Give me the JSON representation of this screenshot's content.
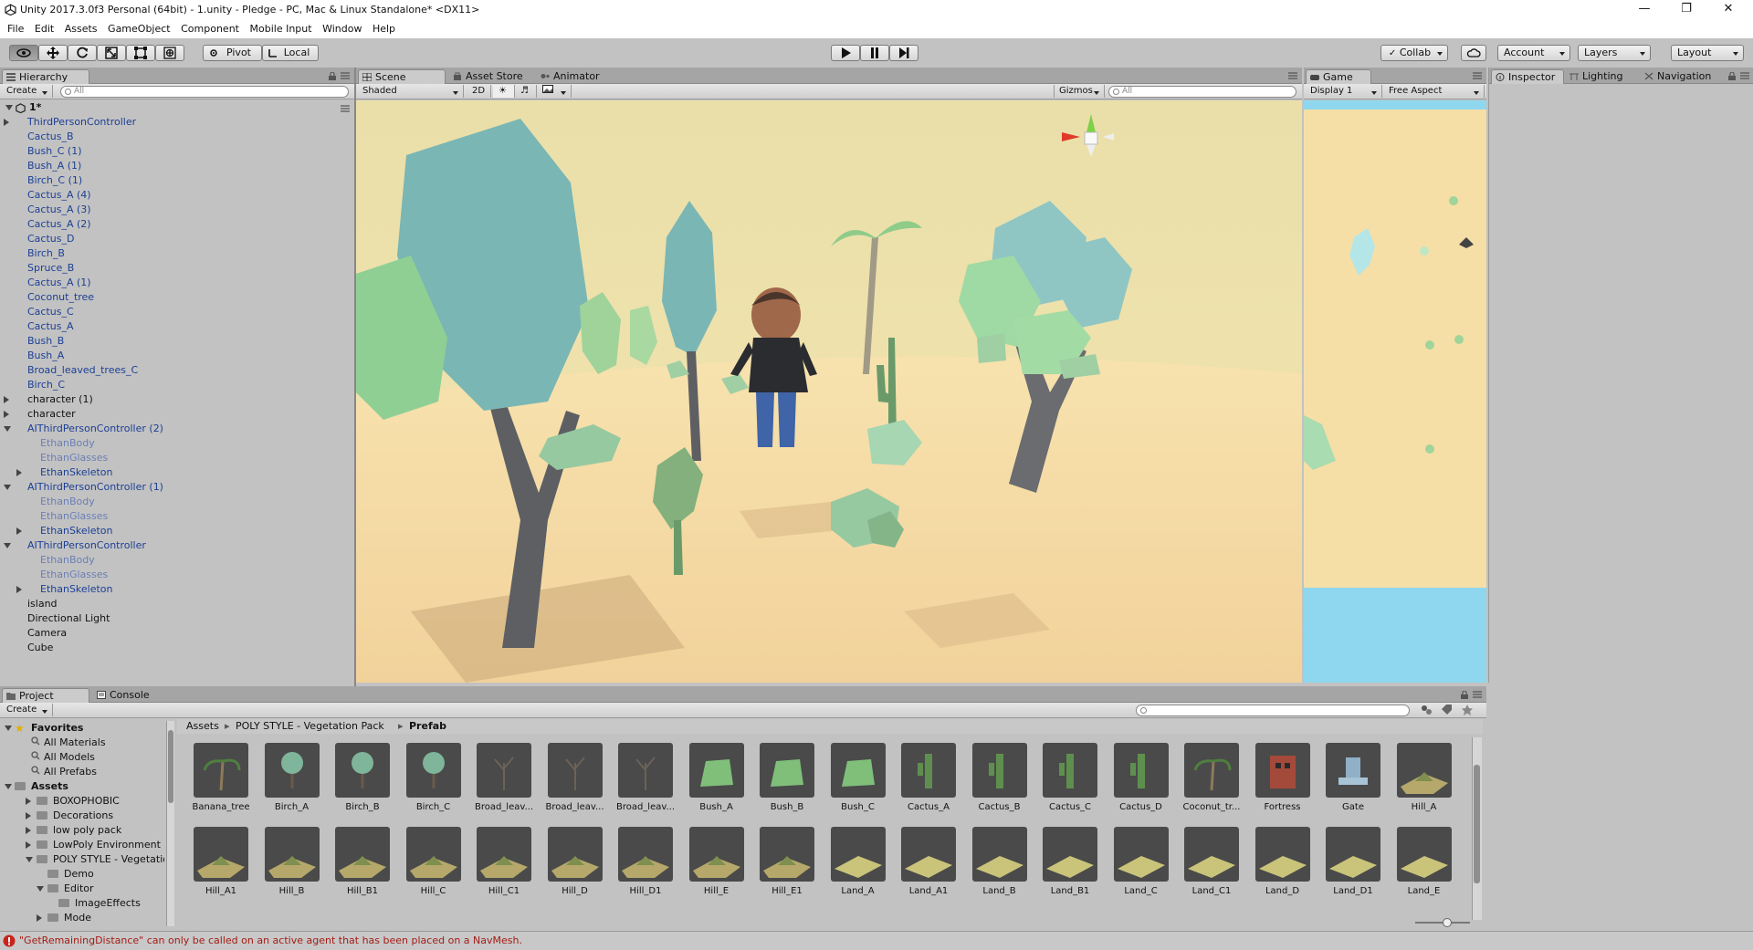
{
  "window": {
    "title": "Unity 2017.3.0f3 Personal (64bit) - 1.unity - Pledge - PC, Mac & Linux Standalone* <DX11>",
    "controls": [
      "—",
      "❐",
      "✕"
    ]
  },
  "menu": [
    "File",
    "Edit",
    "Assets",
    "GameObject",
    "Component",
    "Mobile Input",
    "Window",
    "Help"
  ],
  "toolbar": {
    "pivot": "Pivot",
    "local": "Local",
    "collab": "Collab",
    "account": "Account",
    "layers": "Layers",
    "layout": "Layout"
  },
  "hierarchy": {
    "tab": "Hierarchy",
    "create": "Create",
    "search_placeholder": "All",
    "scene_name": "1*",
    "items": [
      {
        "label": "ThirdPersonController",
        "color": "blue",
        "indent": 0,
        "arrow": "right"
      },
      {
        "label": "Cactus_B",
        "color": "blue",
        "indent": 0,
        "arrow": ""
      },
      {
        "label": "Bush_C (1)",
        "color": "blue",
        "indent": 0,
        "arrow": ""
      },
      {
        "label": "Bush_A (1)",
        "color": "blue",
        "indent": 0,
        "arrow": ""
      },
      {
        "label": "Birch_C (1)",
        "color": "blue",
        "indent": 0,
        "arrow": ""
      },
      {
        "label": "Cactus_A (4)",
        "color": "blue",
        "indent": 0,
        "arrow": ""
      },
      {
        "label": "Cactus_A (3)",
        "color": "blue",
        "indent": 0,
        "arrow": ""
      },
      {
        "label": "Cactus_A (2)",
        "color": "blue",
        "indent": 0,
        "arrow": ""
      },
      {
        "label": "Cactus_D",
        "color": "blue",
        "indent": 0,
        "arrow": ""
      },
      {
        "label": "Birch_B",
        "color": "blue",
        "indent": 0,
        "arrow": ""
      },
      {
        "label": "Spruce_B",
        "color": "blue",
        "indent": 0,
        "arrow": ""
      },
      {
        "label": "Cactus_A (1)",
        "color": "blue",
        "indent": 0,
        "arrow": ""
      },
      {
        "label": "Coconut_tree",
        "color": "blue",
        "indent": 0,
        "arrow": ""
      },
      {
        "label": "Cactus_C",
        "color": "blue",
        "indent": 0,
        "arrow": ""
      },
      {
        "label": "Cactus_A",
        "color": "blue",
        "indent": 0,
        "arrow": ""
      },
      {
        "label": "Bush_B",
        "color": "blue",
        "indent": 0,
        "arrow": ""
      },
      {
        "label": "Bush_A",
        "color": "blue",
        "indent": 0,
        "arrow": ""
      },
      {
        "label": "Broad_leaved_trees_C",
        "color": "blue",
        "indent": 0,
        "arrow": ""
      },
      {
        "label": "Birch_C",
        "color": "blue",
        "indent": 0,
        "arrow": ""
      },
      {
        "label": "character (1)",
        "color": "black",
        "indent": 0,
        "arrow": "right"
      },
      {
        "label": "character",
        "color": "black",
        "indent": 0,
        "arrow": "right"
      },
      {
        "label": "AIThirdPersonController (2)",
        "color": "blue",
        "indent": 0,
        "arrow": "down"
      },
      {
        "label": "EthanBody",
        "color": "lblue",
        "indent": 1,
        "arrow": ""
      },
      {
        "label": "EthanGlasses",
        "color": "lblue",
        "indent": 1,
        "arrow": ""
      },
      {
        "label": "EthanSkeleton",
        "color": "blue",
        "indent": 1,
        "arrow": "right"
      },
      {
        "label": "AIThirdPersonController (1)",
        "color": "blue",
        "indent": 0,
        "arrow": "down"
      },
      {
        "label": "EthanBody",
        "color": "lblue",
        "indent": 1,
        "arrow": ""
      },
      {
        "label": "EthanGlasses",
        "color": "lblue",
        "indent": 1,
        "arrow": ""
      },
      {
        "label": "EthanSkeleton",
        "color": "blue",
        "indent": 1,
        "arrow": "right"
      },
      {
        "label": "AIThirdPersonController",
        "color": "blue",
        "indent": 0,
        "arrow": "down"
      },
      {
        "label": "EthanBody",
        "color": "lblue",
        "indent": 1,
        "arrow": ""
      },
      {
        "label": "EthanGlasses",
        "color": "lblue",
        "indent": 1,
        "arrow": ""
      },
      {
        "label": "EthanSkeleton",
        "color": "blue",
        "indent": 1,
        "arrow": "right"
      },
      {
        "label": "island",
        "color": "black",
        "indent": 0,
        "arrow": ""
      },
      {
        "label": "Directional Light",
        "color": "black",
        "indent": 0,
        "arrow": ""
      },
      {
        "label": "Camera",
        "color": "black",
        "indent": 0,
        "arrow": ""
      },
      {
        "label": "Cube",
        "color": "black",
        "indent": 0,
        "arrow": ""
      }
    ]
  },
  "scene": {
    "tabs": [
      "Scene",
      "Asset Store",
      "Animator"
    ],
    "shading": "Shaded",
    "mode_2d": "2D",
    "gizmos": "Gizmos",
    "search_placeholder": "All"
  },
  "game": {
    "tab": "Game",
    "display": "Display 1",
    "aspect": "Free Aspect"
  },
  "inspector": {
    "tabs": [
      "Inspector",
      "Lighting",
      "Navigation"
    ]
  },
  "project": {
    "tabs": [
      "Project",
      "Console"
    ],
    "create": "Create",
    "breadcrumb": [
      "Assets",
      "POLY STYLE - Vegetation Pack",
      "Prefab"
    ],
    "favorites_label": "Favorites",
    "favorites": [
      "All Materials",
      "All Models",
      "All Prefabs"
    ],
    "assets_label": "Assets",
    "tree": [
      {
        "label": "BOXOPHOBIC",
        "indent": 1,
        "arrow": "right"
      },
      {
        "label": "Decorations",
        "indent": 1,
        "arrow": "right"
      },
      {
        "label": "low poly pack",
        "indent": 1,
        "arrow": "right"
      },
      {
        "label": "LowPoly Environment P",
        "indent": 1,
        "arrow": "right"
      },
      {
        "label": "POLY STYLE - Vegetatio",
        "indent": 1,
        "arrow": "down"
      },
      {
        "label": "Demo",
        "indent": 2,
        "arrow": ""
      },
      {
        "label": "Editor",
        "indent": 2,
        "arrow": "down"
      },
      {
        "label": "ImageEffects",
        "indent": 3,
        "arrow": ""
      },
      {
        "label": "Mode",
        "indent": 2,
        "arrow": "right"
      }
    ],
    "assets_row1": [
      "Banana_tree",
      "Birch_A",
      "Birch_B",
      "Birch_C",
      "Broad_leav...",
      "Broad_leav...",
      "Broad_leav...",
      "Bush_A",
      "Bush_B",
      "Bush_C",
      "Cactus_A",
      "Cactus_B",
      "Cactus_C",
      "Cactus_D",
      "Coconut_tr...",
      "Fortress",
      "Gate",
      "Hill_A"
    ],
    "assets_row2": [
      "Hill_A1",
      "Hill_B",
      "Hill_B1",
      "Hill_C",
      "Hill_C1",
      "Hill_D",
      "Hill_D1",
      "Hill_E",
      "Hill_E1",
      "Land_A",
      "Land_A1",
      "Land_B",
      "Land_B1",
      "Land_C",
      "Land_C1",
      "Land_D",
      "Land_D1",
      "Land_E"
    ]
  },
  "status": {
    "message": "\"GetRemainingDistance\" can only be called on an active agent that has been placed on a NavMesh."
  }
}
